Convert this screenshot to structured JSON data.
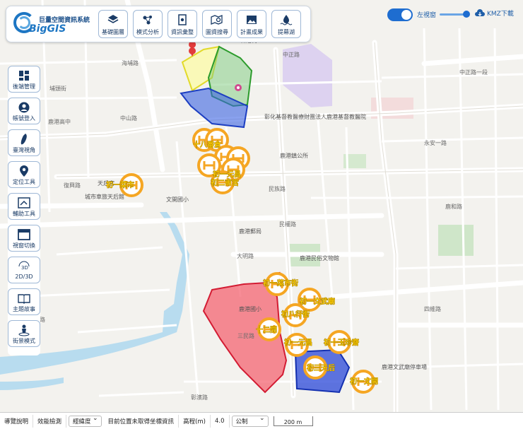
{
  "logo": {
    "text_small": "巨量空間資訊系統",
    "text_big": "BigGIS"
  },
  "topbar": {
    "buttons": [
      {
        "label": "基礎圖層",
        "icon": "layers-icon"
      },
      {
        "label": "模式分析",
        "icon": "analysis-icon"
      },
      {
        "label": "資訊彙整",
        "icon": "report-icon"
      },
      {
        "label": "圖資搜尋",
        "icon": "map-search-icon"
      },
      {
        "label": "計畫成果",
        "icon": "image-icon"
      },
      {
        "label": "提幕湖",
        "icon": "water-icon"
      }
    ]
  },
  "right_controls": {
    "toggle_label": "左視窗",
    "kmz_label": "KMZ下載"
  },
  "sidebar": {
    "items": [
      {
        "label": "後端管理",
        "icon": "dashboard-icon"
      },
      {
        "label": "帳號登入",
        "icon": "user-icon"
      },
      {
        "label": "臺灣視角",
        "icon": "taiwan-icon"
      },
      {
        "label": "定位工具",
        "icon": "location-pin-icon"
      },
      {
        "label": "輔助工具",
        "icon": "tools-icon"
      },
      {
        "label": "視窗切換",
        "icon": "window-icon"
      },
      {
        "label": "2D/3D",
        "icon": "3d-icon"
      },
      {
        "label": "主題故事",
        "icon": "book-icon"
      },
      {
        "label": "街景模式",
        "icon": "pegman-icon"
      }
    ]
  },
  "bottombar": {
    "guide": "導覽說明",
    "performance": "效能檢測",
    "coord_select": "經緯度",
    "coord_status": "目前位置未取得坐標資訊",
    "elevation_label": "高程(m)",
    "elevation_value": "4.0",
    "unit_select": "公制",
    "scale": "200 m"
  },
  "map": {
    "road_labels": [
      "海埔路",
      "中山路",
      "民族路",
      "民權路",
      "中正路",
      "鹿和路",
      "大明路",
      "三民路",
      "彰濱路",
      "鹿港高中",
      "永安一路",
      "復興路",
      "埔頭街",
      "彰鹿路",
      "四維路",
      "中正路一段"
    ],
    "place_labels": [
      "彰化基督教醫療財團法人鹿港基督教醫院",
      "鹿港郵局",
      "鹿港國小",
      "鹿港民俗文物館",
      "文開國小",
      "鹿港鎮公所",
      "新港街",
      "鹿港文武廟停車場",
      "天后宮",
      "城市車旅天后館"
    ],
    "markers": [
      "十八番倉",
      "初一菜市",
      "初一玉珍齋",
      "初一武廟",
      "初一文開",
      "初三天后",
      "初三東石",
      "初八行街",
      "初四長樂",
      "十二間",
      "初一元昌",
      "初二甫宮",
      "初一文武廟"
    ],
    "labels_visible": [
      "初一菜市街",
      "初八行街",
      "十二間",
      "初一元昌",
      "初一文武廟",
      "初三天后",
      "十八番倉"
    ]
  }
}
